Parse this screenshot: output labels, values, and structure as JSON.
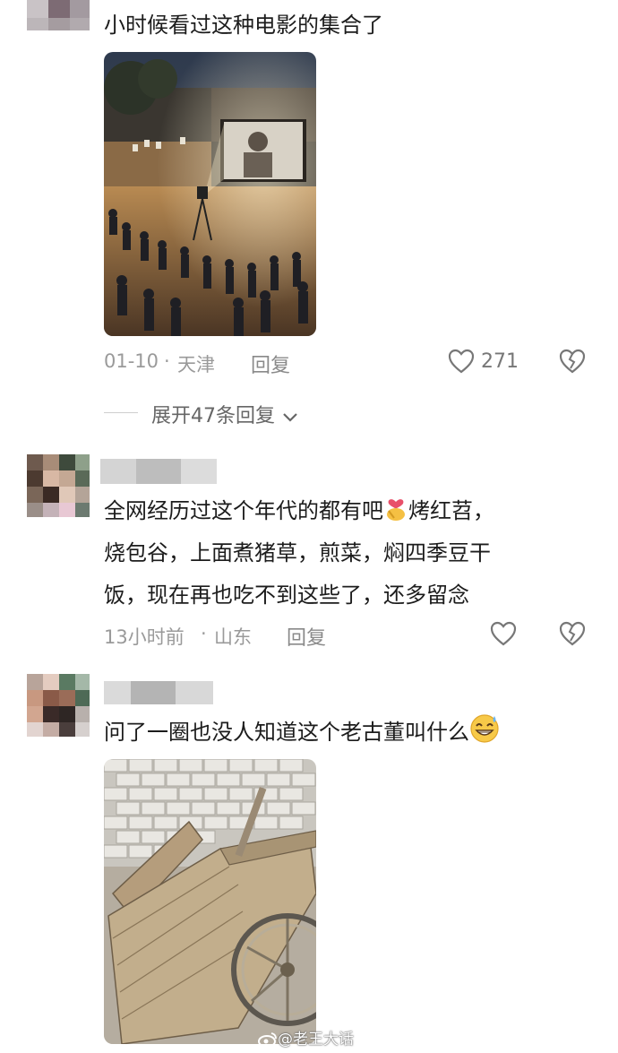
{
  "comments": [
    {
      "text": "小时候看过这种电影的集合了",
      "date": "01-10",
      "location": "天津",
      "reply_label": "回复",
      "likes": "271",
      "expand_label": "展开47条回复"
    },
    {
      "text_lines": [
        "全网经历过这个年代的都有吧",
        "烤红苕，",
        "烧包谷，上面煮猪草，煎菜，焖四季豆干",
        "饭，现在再也吃不到这些了，还多留念"
      ],
      "emoji": "heart-hand-emoji",
      "date": "13小时前",
      "location": "山东",
      "reply_label": "回复"
    },
    {
      "text": "问了一圈也没人知道这个老古董叫什么",
      "emoji": "grin-sweat-emoji"
    }
  ],
  "watermark": "@老王大话",
  "colors": {
    "text": "#1c1c1c",
    "meta": "#9a9a9a",
    "icon": "#777777"
  }
}
